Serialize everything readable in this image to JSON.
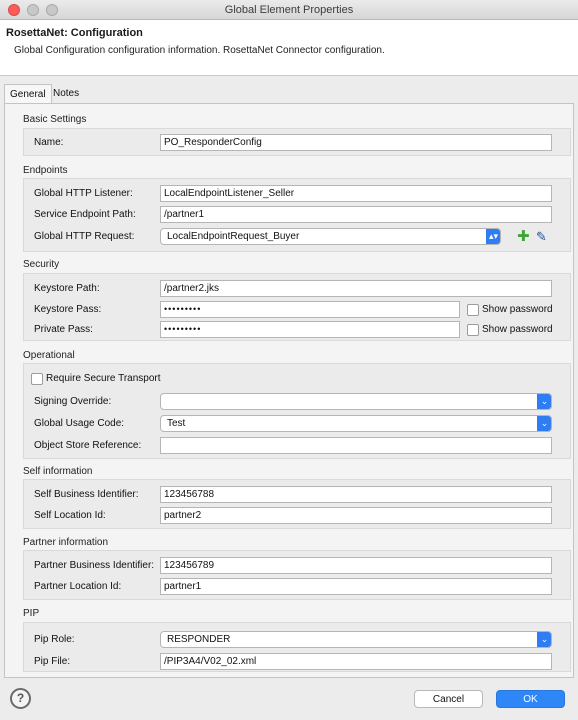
{
  "window": {
    "title": "Global Element Properties"
  },
  "header": {
    "title": "RosettaNet: Configuration",
    "description": "Global Configuration configuration information. RosettaNet Connector configuration."
  },
  "tabs": [
    {
      "label": "General",
      "active": true
    },
    {
      "label": "Notes",
      "active": false
    }
  ],
  "basic": {
    "title": "Basic Settings",
    "name_label": "Name:",
    "name_value": "PO_ResponderConfig"
  },
  "endpoints": {
    "title": "Endpoints",
    "listener_label": "Global HTTP Listener:",
    "listener_value": "LocalEndpointListener_Seller",
    "path_label": "Service Endpoint Path:",
    "path_value": "/partner1",
    "request_label": "Global HTTP Request:",
    "request_value": "LocalEndpointRequest_Buyer"
  },
  "security": {
    "title": "Security",
    "keystore_path_label": "Keystore Path:",
    "keystore_path_value": "/partner2.jks",
    "keystore_pass_label": "Keystore Pass:",
    "keystore_pass_value": "•••••••••",
    "private_pass_label": "Private Pass:",
    "private_pass_value": "•••••••••",
    "show_password_label": "Show password"
  },
  "operational": {
    "title": "Operational",
    "secure_transport_label": "Require Secure Transport",
    "signing_override_label": "Signing Override:",
    "signing_override_value": "",
    "usage_code_label": "Global Usage Code:",
    "usage_code_value": "Test",
    "object_store_label": "Object Store Reference:",
    "object_store_value": ""
  },
  "self_info": {
    "title": "Self information",
    "business_id_label": "Self Business Identifier:",
    "business_id_value": "123456788",
    "location_id_label": "Self Location Id:",
    "location_id_value": "partner2"
  },
  "partner_info": {
    "title": "Partner information",
    "business_id_label": "Partner Business Identifier:",
    "business_id_value": "123456789",
    "location_id_label": "Partner Location Id:",
    "location_id_value": "partner1"
  },
  "pip": {
    "title": "PIP",
    "role_label": "Pip Role:",
    "role_value": "RESPONDER",
    "file_label": "Pip File:",
    "file_value": "/PIP3A4/V02_02.xml"
  },
  "footer": {
    "help_icon": "?",
    "cancel_label": "Cancel",
    "ok_label": "OK"
  },
  "icons": {
    "add": "add-plus-icon",
    "edit": "edit-icon",
    "dropdown": "chevron-down-icon"
  },
  "colors": {
    "accent": "#2f86f6",
    "close_button": "#fc5b57",
    "add_icon": "#3fa635"
  }
}
